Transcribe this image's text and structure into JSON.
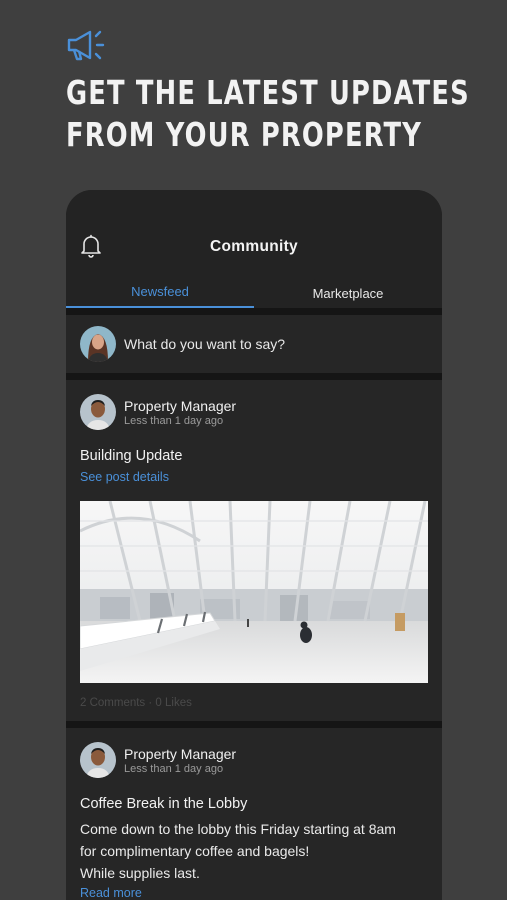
{
  "promo": {
    "icon": "megaphone-icon",
    "headline_line1": "GET THE LATEST UPDATES",
    "headline_line2": "FROM YOUR PROPERTY",
    "accent_color": "#4a90d9"
  },
  "app": {
    "title": "Community",
    "bell_icon": "bell-icon",
    "tabs": [
      {
        "label": "Newsfeed",
        "active": true
      },
      {
        "label": "Marketplace",
        "active": false
      }
    ],
    "compose": {
      "placeholder": "What do you want to say?"
    },
    "posts": [
      {
        "author": "Property Manager",
        "time": "Less than 1 day ago",
        "title": "Building Update",
        "link": "See post details",
        "stats": "2 Comments · 0 Likes"
      },
      {
        "author": "Property Manager",
        "time": "Less than 1 day ago",
        "title": "Coffee Break in the Lobby",
        "body_line1": "Come down to the lobby this Friday starting at 8am",
        "body_line2": "for complimentary coffee and bagels!",
        "body_line3": "While supplies last.",
        "link": "Read more"
      }
    ]
  }
}
